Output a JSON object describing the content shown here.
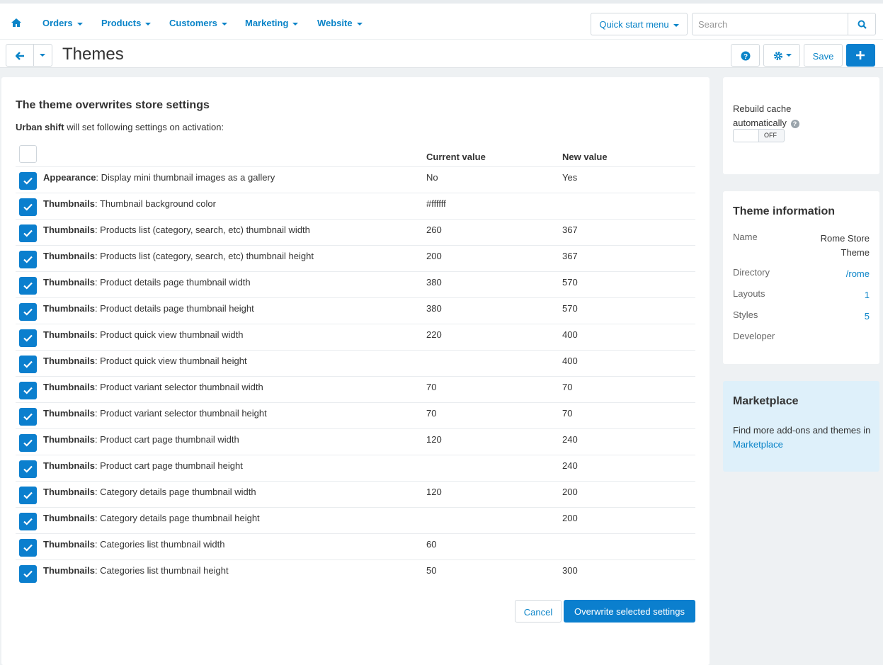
{
  "nav": {
    "items": [
      {
        "label": "Orders"
      },
      {
        "label": "Products"
      },
      {
        "label": "Customers"
      },
      {
        "label": "Marketing"
      },
      {
        "label": "Website"
      }
    ],
    "quick_start": "Quick start menu",
    "search_placeholder": "Search"
  },
  "toolbar": {
    "title": "Themes",
    "save_label": "Save"
  },
  "main": {
    "heading": "The theme overwrites store settings",
    "sub_bold": "Urban shift",
    "sub_rest": " will set following settings on activation:",
    "col_current": "Current value",
    "col_new": "New value",
    "rows": [
      {
        "group": "Appearance",
        "setting": ": Display mini thumbnail images as a gallery",
        "current": "No",
        "new": "Yes",
        "checked": true
      },
      {
        "group": "Thumbnails",
        "setting": ": Thumbnail background color",
        "current": "#ffffff",
        "new": "",
        "checked": true
      },
      {
        "group": "Thumbnails",
        "setting": ": Products list (category, search, etc) thumbnail width",
        "current": "260",
        "new": "367",
        "checked": true
      },
      {
        "group": "Thumbnails",
        "setting": ": Products list (category, search, etc) thumbnail height",
        "current": "200",
        "new": "367",
        "checked": true
      },
      {
        "group": "Thumbnails",
        "setting": ": Product details page thumbnail width",
        "current": "380",
        "new": "570",
        "checked": true
      },
      {
        "group": "Thumbnails",
        "setting": ": Product details page thumbnail height",
        "current": "380",
        "new": "570",
        "checked": true
      },
      {
        "group": "Thumbnails",
        "setting": ": Product quick view thumbnail width",
        "current": "220",
        "new": "400",
        "checked": true
      },
      {
        "group": "Thumbnails",
        "setting": ": Product quick view thumbnail height",
        "current": "",
        "new": "400",
        "checked": true
      },
      {
        "group": "Thumbnails",
        "setting": ": Product variant selector thumbnail width",
        "current": "70",
        "new": "70",
        "checked": true
      },
      {
        "group": "Thumbnails",
        "setting": ": Product variant selector thumbnail height",
        "current": "70",
        "new": "70",
        "checked": true
      },
      {
        "group": "Thumbnails",
        "setting": ": Product cart page thumbnail width",
        "current": "120",
        "new": "240",
        "checked": true
      },
      {
        "group": "Thumbnails",
        "setting": ": Product cart page thumbnail height",
        "current": "",
        "new": "240",
        "checked": true
      },
      {
        "group": "Thumbnails",
        "setting": ": Category details page thumbnail width",
        "current": "120",
        "new": "200",
        "checked": true
      },
      {
        "group": "Thumbnails",
        "setting": ": Category details page thumbnail height",
        "current": "",
        "new": "200",
        "checked": true
      },
      {
        "group": "Thumbnails",
        "setting": ": Categories list thumbnail width",
        "current": "60",
        "new": "",
        "checked": true
      },
      {
        "group": "Thumbnails",
        "setting": ": Categories list thumbnail height",
        "current": "50",
        "new": "300",
        "checked": true
      }
    ],
    "cancel_label": "Cancel",
    "overwrite_label": "Overwrite selected settings"
  },
  "sidebar": {
    "rebuild_label": "Rebuild cache automatically",
    "toggle_state": "OFF",
    "theme_info_title": "Theme information",
    "info": [
      {
        "key": "Name",
        "value": "Rome Store Theme",
        "link": false
      },
      {
        "key": "Directory",
        "value": "/rome",
        "link": true
      },
      {
        "key": "Layouts",
        "value": "1",
        "link": true
      },
      {
        "key": "Styles",
        "value": "5",
        "link": true
      },
      {
        "key": "Developer",
        "value": "",
        "link": false
      }
    ],
    "marketplace_title": "Marketplace",
    "marketplace_text": "Find more add-ons and themes in ",
    "marketplace_link": "Marketplace"
  },
  "colors": {
    "accent": "#0b7fce",
    "link": "#0a84c8",
    "marketplace_bg": "#def0fa"
  }
}
